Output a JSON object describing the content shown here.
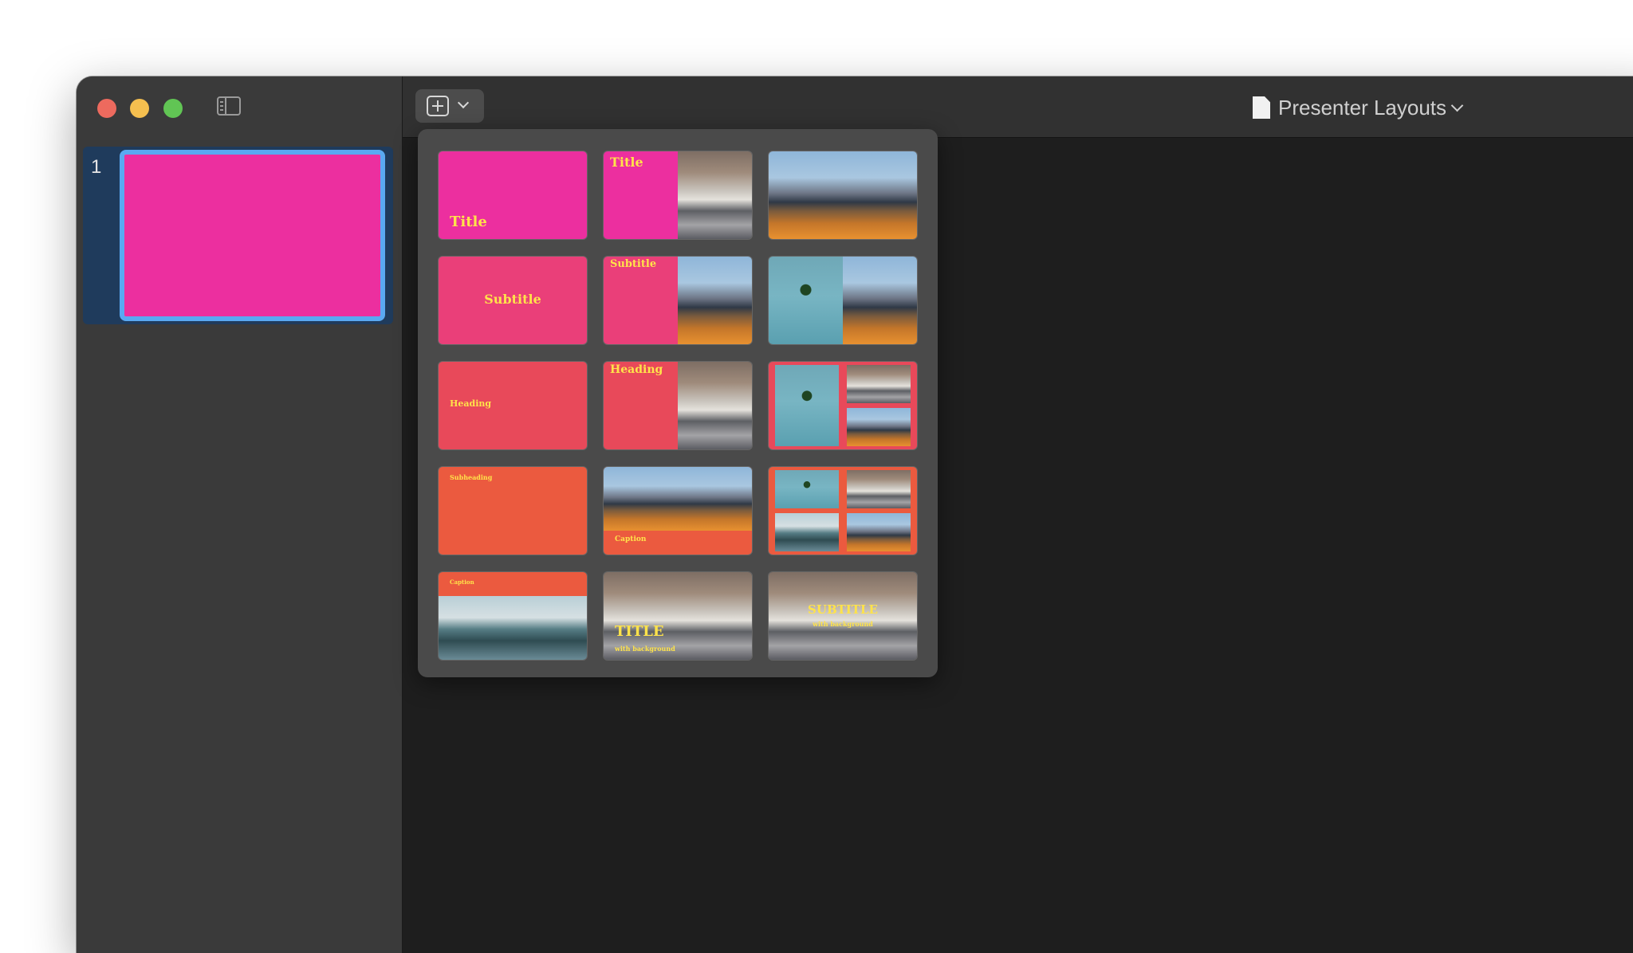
{
  "sidebar": {
    "slide_number": "1"
  },
  "toolbar": {
    "add_slide_button": "add-slide",
    "document_title": "Presenter Layouts"
  },
  "layouts": {
    "title": "Title",
    "subtitle": "Subtitle",
    "heading": "Heading",
    "subheading": "Subheading",
    "caption": "Caption",
    "title_upper": "TITLE",
    "subtitle_upper": "SUBTITLE",
    "with_background": "with background"
  },
  "colors": {
    "pink": "#ec2f9f",
    "rose": "#ea3f79",
    "coral": "#e8495a",
    "orange_red": "#eb5a3f",
    "sidebar_selection": "#5aa9f2"
  }
}
